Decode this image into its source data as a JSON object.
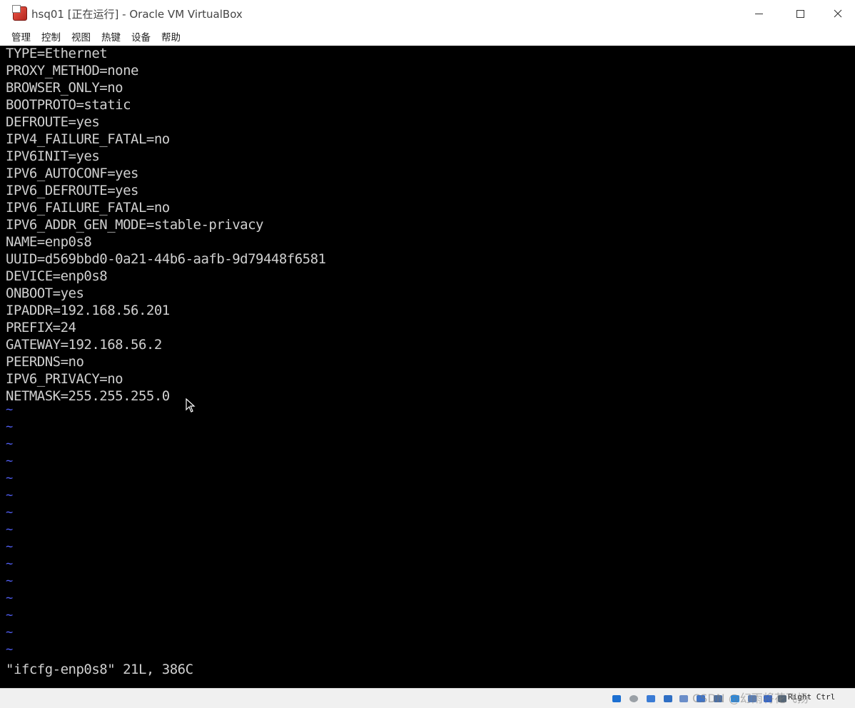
{
  "window": {
    "title": "hsq01 [正在运行] - Oracle VM VirtualBox",
    "icon": "virtualbox-vm-icon",
    "controls": [
      "minimize",
      "maximize",
      "close"
    ]
  },
  "menu": {
    "items": [
      "管理",
      "控制",
      "视图",
      "热键",
      "设备",
      "帮助"
    ]
  },
  "terminal": {
    "lines": [
      "TYPE=Ethernet",
      "PROXY_METHOD=none",
      "BROWSER_ONLY=no",
      "BOOTPROTO=static",
      "DEFROUTE=yes",
      "IPV4_FAILURE_FATAL=no",
      "IPV6INIT=yes",
      "IPV6_AUTOCONF=yes",
      "IPV6_DEFROUTE=yes",
      "IPV6_FAILURE_FATAL=no",
      "IPV6_ADDR_GEN_MODE=stable-privacy",
      "NAME=enp0s8",
      "UUID=d569bbd0-0a21-44b6-aafb-9d79448f6581",
      "DEVICE=enp0s8",
      "ONBOOT=yes",
      "IPADDR=192.168.56.201",
      "PREFIX=24",
      "GATEWAY=192.168.56.2",
      "PEERDNS=no",
      "IPV6_PRIVACY=no",
      "NETMASK=255.255.255.0"
    ],
    "empty_line_marker": "~",
    "empty_line_count": 15,
    "status_line": "\"ifcfg-enp0s8\" 21L, 386C",
    "colors": {
      "background": "#000000",
      "text": "#d0d0d0",
      "tilde": "#4f5df0"
    }
  },
  "statusbar": {
    "icons": [
      "hard-disk-icon",
      "optical-drive-icon",
      "audio-icon",
      "network-icon",
      "usb-icon",
      "shared-folders-icon",
      "display-icon",
      "video-capture-icon",
      "cpu-icon",
      "mouse-integration-icon",
      "keyboard-icon"
    ],
    "host_key": "Right Ctrl",
    "watermark": "CSDN @幻雨将花飞扬"
  }
}
